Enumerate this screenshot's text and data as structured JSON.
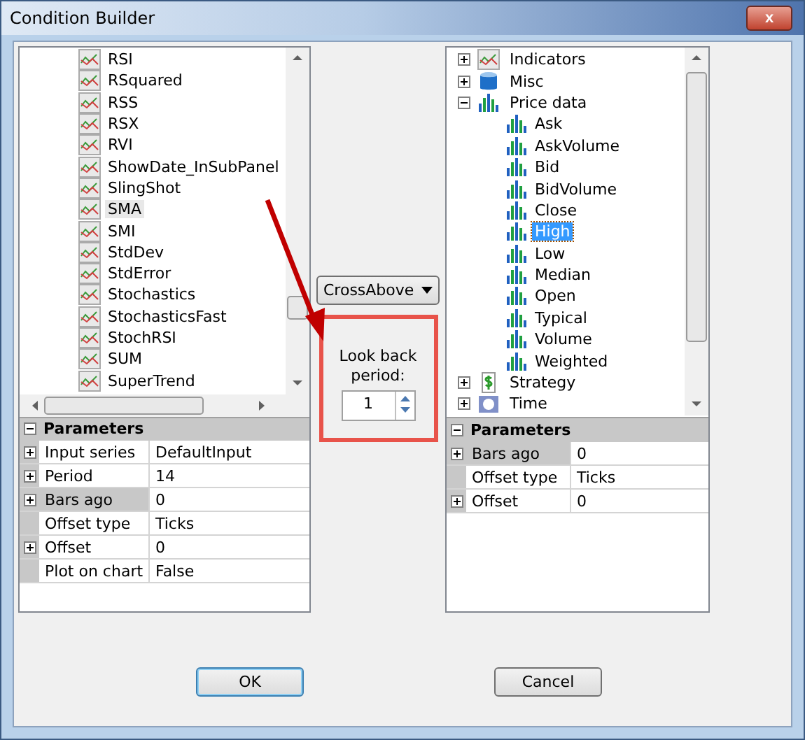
{
  "window": {
    "title": "Condition Builder",
    "close": "x"
  },
  "left_list": {
    "items": [
      {
        "label": "RSI",
        "selected": false
      },
      {
        "label": "RSquared",
        "selected": false
      },
      {
        "label": "RSS",
        "selected": false
      },
      {
        "label": "RSX",
        "selected": false
      },
      {
        "label": "RVI",
        "selected": false
      },
      {
        "label": "ShowDate_InSubPanel",
        "selected": false
      },
      {
        "label": "SlingShot",
        "selected": false
      },
      {
        "label": "SMA",
        "selected": true
      },
      {
        "label": "SMI",
        "selected": false
      },
      {
        "label": "StdDev",
        "selected": false
      },
      {
        "label": "StdError",
        "selected": false
      },
      {
        "label": "Stochastics",
        "selected": false
      },
      {
        "label": "StochasticsFast",
        "selected": false
      },
      {
        "label": "StochRSI",
        "selected": false
      },
      {
        "label": "SUM",
        "selected": false
      },
      {
        "label": "SuperTrend",
        "selected": false
      }
    ]
  },
  "left_params": {
    "header": "Parameters",
    "expanded": true,
    "rows": [
      {
        "kind": "group",
        "name": "Input series",
        "value": "DefaultInput",
        "selected": false
      },
      {
        "kind": "group",
        "name": "Period",
        "value": "14",
        "selected": false
      },
      {
        "kind": "group",
        "name": "Bars ago",
        "value": "0",
        "selected": true
      },
      {
        "kind": "plain",
        "name": "Offset type",
        "value": "Ticks",
        "selected": false
      },
      {
        "kind": "group",
        "name": "Offset",
        "value": "0",
        "selected": false
      },
      {
        "kind": "plain",
        "name": "Plot on chart",
        "value": "False",
        "selected": false
      }
    ]
  },
  "operator": {
    "value": "CrossAbove"
  },
  "look_back": {
    "label": "Look back period:",
    "value": "1"
  },
  "right_tree": {
    "items": [
      {
        "label": "Indicators",
        "expanded": false,
        "selected": false
      },
      {
        "label": "Misc",
        "expanded": false,
        "selected": false
      },
      {
        "label": "Price data",
        "expanded": true,
        "selected": false,
        "children": [
          {
            "label": "Ask",
            "selected": false
          },
          {
            "label": "AskVolume",
            "selected": false
          },
          {
            "label": "Bid",
            "selected": false
          },
          {
            "label": "BidVolume",
            "selected": false
          },
          {
            "label": "Close",
            "selected": false
          },
          {
            "label": "High",
            "selected": true
          },
          {
            "label": "Low",
            "selected": false
          },
          {
            "label": "Median",
            "selected": false
          },
          {
            "label": "Open",
            "selected": false
          },
          {
            "label": "Typical",
            "selected": false
          },
          {
            "label": "Volume",
            "selected": false
          },
          {
            "label": "Weighted",
            "selected": false
          }
        ]
      },
      {
        "label": "Strategy",
        "expanded": false,
        "selected": false
      },
      {
        "label": "Time",
        "expanded": false,
        "selected": false
      }
    ]
  },
  "right_params": {
    "header": "Parameters",
    "expanded": true,
    "rows": [
      {
        "kind": "group",
        "name": "Bars ago",
        "value": "0",
        "selected": true
      },
      {
        "kind": "plain",
        "name": "Offset type",
        "value": "Ticks",
        "selected": false
      },
      {
        "kind": "group",
        "name": "Offset",
        "value": "0",
        "selected": false
      }
    ]
  },
  "buttons": [
    {
      "label": "OK",
      "kind": "default"
    },
    {
      "label": "Cancel",
      "kind": "normal"
    }
  ]
}
